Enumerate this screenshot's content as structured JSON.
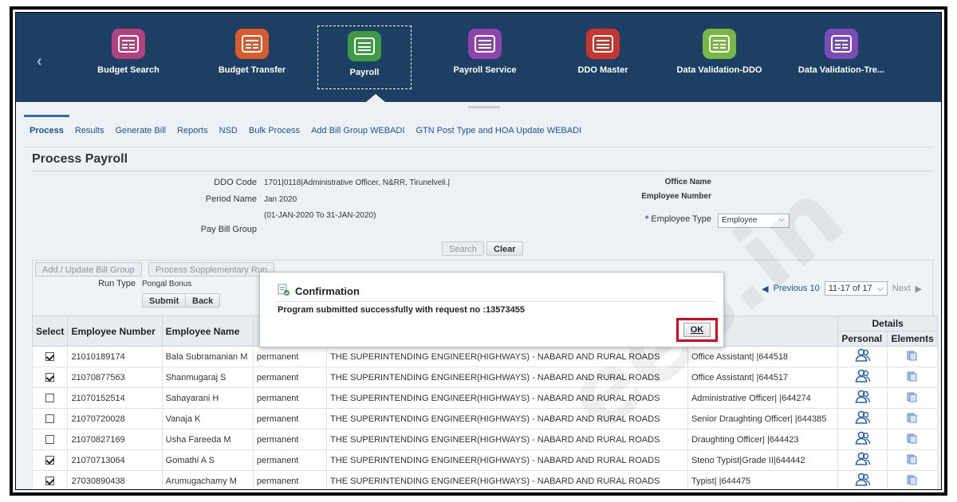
{
  "springboard": {
    "items": [
      {
        "label": "Budget Search",
        "color": "#b2417f"
      },
      {
        "label": "Budget Transfer",
        "color": "#d95a2b"
      },
      {
        "label": "Payroll",
        "color": "#3f9b43"
      },
      {
        "label": "Payroll Service",
        "color": "#8e44ad"
      },
      {
        "label": "DDO Master",
        "color": "#c8352e"
      },
      {
        "label": "Data Validation-DDO",
        "color": "#78b743"
      },
      {
        "label": "Data Validation-Tre...",
        "color": "#7b4bb8"
      }
    ]
  },
  "tabs": [
    {
      "label": "Process"
    },
    {
      "label": "Results"
    },
    {
      "label": "Generate Bill"
    },
    {
      "label": "Reports"
    },
    {
      "label": "NSD"
    },
    {
      "label": "Bulk Process"
    },
    {
      "label": "Add Bill Group WEBADI"
    },
    {
      "label": "GTN Post Type and HOA Update WEBADI"
    }
  ],
  "page": {
    "title": "Process Payroll"
  },
  "form": {
    "ddo_code_label": "DDO Code",
    "ddo_code_value": "1701|0118|Administrative Officer, N&RR, Tirunelveli.|",
    "period_name_label": "Period Name",
    "period_name_value": "Jan 2020",
    "period_range": "(01-JAN-2020 To 31-JAN-2020)",
    "pay_bill_group_label": "Pay Bill Group",
    "office_name_label": "Office Name",
    "employee_number_label": "Employee Number",
    "employee_type_label": "Employee Type",
    "employee_type_value": "Employee",
    "search_label": "Search",
    "clear_label": "Clear"
  },
  "results": {
    "add_update_bill_group": "Add / Update Bill Group",
    "process_supplementary_run": "Process Supplementary Run",
    "run_type_label": "Run Type",
    "run_type_value": "Pongal Bonus",
    "submit_label": "Submit",
    "back_label": "Back",
    "previous_label": "Previous 10",
    "range_label": "11-17 of 17",
    "next_label": "Next"
  },
  "table": {
    "headers": {
      "select": "Select",
      "employee_number": "Employee Number",
      "employee_name": "Employee Name",
      "details": "Details",
      "personal": "Personal",
      "elements": "Elements"
    },
    "rows": [
      {
        "checked": true,
        "number": "21010189174",
        "name": "Bala Subramanian M",
        "status": "permanent",
        "office": "THE SUPERINTENDING ENGINEER(HIGHWAYS) - NABARD AND RURAL ROADS",
        "position": "Office Assistant| |644518"
      },
      {
        "checked": true,
        "number": "21070877563",
        "name": "Shanmugaraj S",
        "status": "permanent",
        "office": "THE SUPERINTENDING ENGINEER(HIGHWAYS) - NABARD AND RURAL ROADS",
        "position": "Office Assistant| |644517"
      },
      {
        "checked": false,
        "number": "21070152514",
        "name": "Sahayarani H",
        "status": "permanent",
        "office": "THE SUPERINTENDING ENGINEER(HIGHWAYS) - NABARD AND RURAL ROADS",
        "position": "Administrative Officer| |644274"
      },
      {
        "checked": false,
        "number": "21070720028",
        "name": "Vanaja K",
        "status": "permanent",
        "office": "THE SUPERINTENDING ENGINEER(HIGHWAYS) - NABARD AND RURAL ROADS",
        "position": "Senior Draughting Officer| |644385"
      },
      {
        "checked": false,
        "number": "21070827169",
        "name": "Usha Fareeda M",
        "status": "permanent",
        "office": "THE SUPERINTENDING ENGINEER(HIGHWAYS) - NABARD AND RURAL ROADS",
        "position": "Draughting Officer| |644423"
      },
      {
        "checked": true,
        "number": "21070713064",
        "name": "Gomathi A S",
        "status": "permanent",
        "office": "THE SUPERINTENDING ENGINEER(HIGHWAYS) - NABARD AND RURAL ROADS",
        "position": "Steno Typist|Grade II|644442"
      },
      {
        "checked": true,
        "number": "27030890438",
        "name": "Arumugachamy M",
        "status": "permanent",
        "office": "THE SUPERINTENDING ENGINEER(HIGHWAYS) - NABARD AND RURAL ROADS",
        "position": "Typist| |644475"
      }
    ]
  },
  "dialog": {
    "title": "Confirmation",
    "message": "Program submitted successfully with request no :13573455",
    "ok_label": "OK"
  },
  "watermark": "ees.in",
  "icons": {
    "back": "chevron-left-icon",
    "personal": "people-icon",
    "elements": "document-icon",
    "dialog": "confirmation-icon"
  }
}
